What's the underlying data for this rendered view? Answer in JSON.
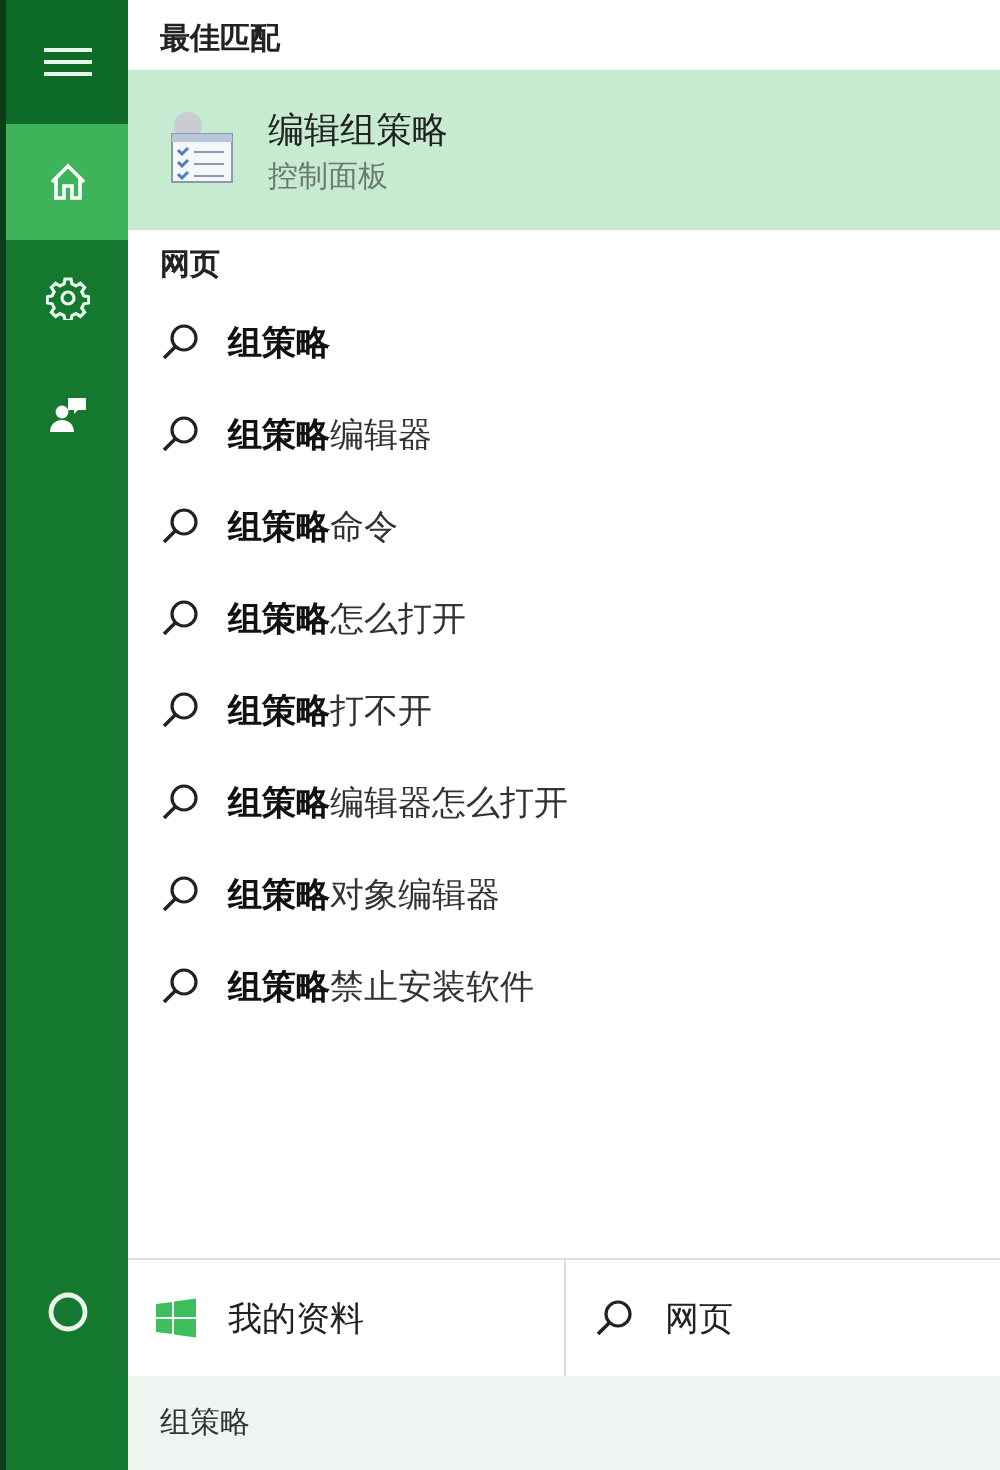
{
  "sidebar": {
    "items": [
      {
        "kind": "menu",
        "selected": false
      },
      {
        "kind": "home",
        "selected": true
      },
      {
        "kind": "settings",
        "selected": false
      },
      {
        "kind": "feedback",
        "selected": false
      }
    ],
    "bottom_items": [
      {
        "kind": "cortana",
        "selected": false
      }
    ]
  },
  "best_match": {
    "heading": "最佳匹配",
    "title": "编辑组策略",
    "subtitle": "控制面板",
    "selected": true
  },
  "web": {
    "heading": "网页",
    "suggestions": [
      {
        "text": "**组策略**"
      },
      {
        "text": "**组策略**编辑器"
      },
      {
        "text": "**组策略**命令"
      },
      {
        "text": "**组策略**怎么打开"
      },
      {
        "text": "**组策略**打不开"
      },
      {
        "text": "**组策略**编辑器怎么打开"
      },
      {
        "text": "**组策略**对象编辑器"
      },
      {
        "text": "**组策略**禁止安装软件"
      }
    ]
  },
  "filters": [
    {
      "kind": "windows",
      "label": "我的资料"
    },
    {
      "kind": "search",
      "label": "网页"
    }
  ],
  "search_box": {
    "value": "组策略"
  }
}
